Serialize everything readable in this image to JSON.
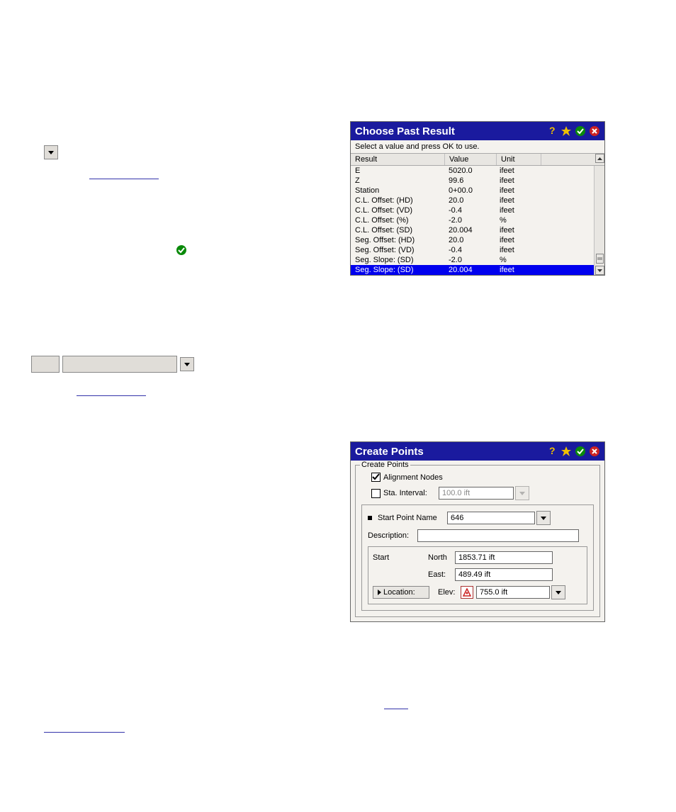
{
  "choose": {
    "title": "Choose Past Result",
    "subtitle": "Select a value and press OK to use.",
    "columns": {
      "result": "Result",
      "value": "Value",
      "unit": "Unit"
    },
    "rows": [
      {
        "result": "E",
        "value": "5020.0",
        "unit": "ifeet",
        "selected": false
      },
      {
        "result": "Z",
        "value": "99.6",
        "unit": "ifeet",
        "selected": false
      },
      {
        "result": "Station",
        "value": "0+00.0",
        "unit": "ifeet",
        "selected": false
      },
      {
        "result": "C.L. Offset: (HD)",
        "value": "20.0",
        "unit": "ifeet",
        "selected": false
      },
      {
        "result": "C.L. Offset: (VD)",
        "value": "-0.4",
        "unit": "ifeet",
        "selected": false
      },
      {
        "result": "C.L. Offset: (%)",
        "value": "-2.0",
        "unit": "%",
        "selected": false
      },
      {
        "result": "C.L. Offset: (SD)",
        "value": "20.004",
        "unit": "ifeet",
        "selected": false
      },
      {
        "result": "Seg. Offset: (HD)",
        "value": "20.0",
        "unit": "ifeet",
        "selected": false
      },
      {
        "result": "Seg. Offset: (VD)",
        "value": "-0.4",
        "unit": "ifeet",
        "selected": false
      },
      {
        "result": "Seg. Slope: (SD)",
        "value": "-2.0",
        "unit": "%",
        "selected": false
      },
      {
        "result": "Seg. Slope: (SD)",
        "value": "20.004",
        "unit": "ifeet",
        "selected": true
      }
    ]
  },
  "create": {
    "title": "Create Points",
    "group_label": "Create Points",
    "alignment_nodes": {
      "label": "Alignment Nodes",
      "checked": true
    },
    "sta_interval": {
      "label": "Sta. Interval:",
      "checked": false,
      "value": "100.0 ift"
    },
    "start_point_name": {
      "label": "Start Point Name",
      "value": "646"
    },
    "description": {
      "label": "Description:",
      "value": ""
    },
    "start_label": "Start",
    "north": {
      "label": "North",
      "value": "1853.71 ift"
    },
    "east": {
      "label": "East:",
      "value": "489.49 ift"
    },
    "elev": {
      "label": "Elev:",
      "value": "755.0 ift"
    },
    "location_btn": "Location:"
  }
}
